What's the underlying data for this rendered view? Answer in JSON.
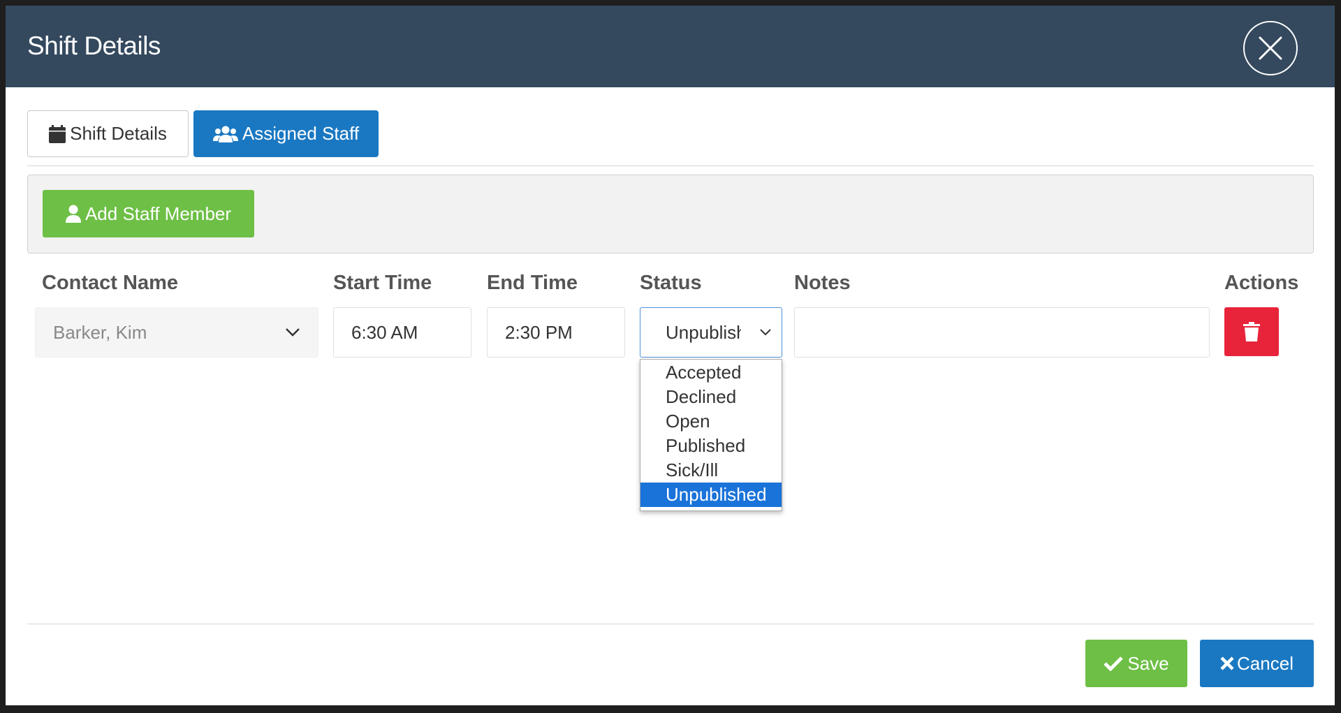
{
  "modal": {
    "title": "Shift Details"
  },
  "tabs": [
    {
      "label": "Shift Details",
      "icon": "calendar-icon",
      "active": false
    },
    {
      "label": "Assigned Staff",
      "icon": "users-icon",
      "active": true
    }
  ],
  "toolbar": {
    "add_staff_label": "Add Staff Member"
  },
  "columns": {
    "contact_name": "Contact Name",
    "start_time": "Start Time",
    "end_time": "End Time",
    "status": "Status",
    "notes": "Notes",
    "actions": "Actions"
  },
  "row": {
    "contact_name": "Barker, Kim",
    "start_time": "6:30 AM",
    "end_time": "2:30 PM",
    "status": "Unpublished",
    "notes": ""
  },
  "status_options": [
    "Accepted",
    "Declined",
    "Open",
    "Published",
    "Sick/Ill",
    "Unpublished"
  ],
  "footer": {
    "save_label": "Save",
    "cancel_label": "Cancel"
  },
  "colors": {
    "header": "#34495e",
    "primary": "#1a78c2",
    "success": "#6dbf45",
    "danger": "#e8243a",
    "selected_option": "#1a73d9"
  }
}
